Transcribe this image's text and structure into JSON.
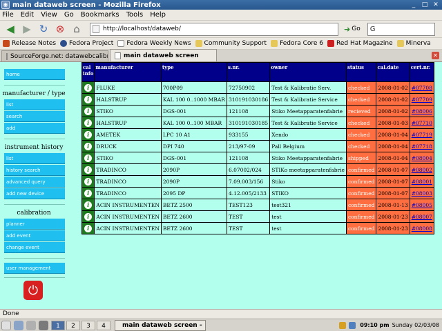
{
  "window": {
    "title": "main dataweb screen - Mozilla Firefox"
  },
  "menu": [
    "File",
    "Edit",
    "View",
    "Go",
    "Bookmarks",
    "Tools",
    "Help"
  ],
  "nav": {
    "url": "http://localhost/dataweb/",
    "go_label": "Go"
  },
  "bookmarks": [
    {
      "label": "Release Notes",
      "color": "#c64a1b"
    },
    {
      "label": "Fedora Project",
      "color": "#2b4d8c"
    },
    {
      "label": "Fedora Weekly News",
      "color": "#ffffff"
    },
    {
      "label": "Community Support",
      "color": "#e6c85a"
    },
    {
      "label": "Fedora Core 6",
      "color": "#e6c85a"
    },
    {
      "label": "Red Hat Magazine",
      "color": "#cc2020"
    },
    {
      "label": "Minerva",
      "color": "#e6c85a"
    }
  ],
  "tabs": [
    {
      "label": "SourceForge.net: datawebcalibr..."
    },
    {
      "label": "main dataweb screen"
    }
  ],
  "sidebar": {
    "home": "home",
    "section1": "manufacturer / type",
    "s1_items": [
      "list",
      "search",
      "add"
    ],
    "section2": "instrument history",
    "s2_items": [
      "list",
      "history search",
      "advanced query",
      "add new device"
    ],
    "section3": "calibration",
    "s3_items": [
      "planner",
      "add event",
      "change event"
    ],
    "user_management": "user management"
  },
  "table": {
    "headers": [
      "cal info",
      "manufacturer",
      "type",
      "s.nr.",
      "owner",
      "status",
      "cal.date",
      "cert.nr."
    ],
    "rows": [
      [
        "FLUKE",
        "700P09",
        "72750902",
        "Test & Kalibratie Serv.",
        "checked",
        "2008-01-02",
        "#07708"
      ],
      [
        "HALSTRUP",
        "KAL 100 0..1000 MBAR",
        "310191030186",
        "Test & Kalibratie Service",
        "checked",
        "2008-01-02",
        "#07709"
      ],
      [
        "STIKO",
        "DGS-001",
        "121108",
        "Stiko Meetapparatenfabrie",
        "recieved",
        "2008-01-02",
        "#08006"
      ],
      [
        "HALSTRUP",
        "KAL 100 0..100 MBAR",
        "310191030185",
        "Test & Kalibratie Service",
        "checked",
        "2008-01-03",
        "#07710"
      ],
      [
        "AMETEK",
        "LPC 10 A1",
        "933155",
        "Xendo",
        "checked",
        "2008-01-04",
        "#07719"
      ],
      [
        "DRUCK",
        "DPI 740",
        "213/97-09",
        "Pall Belgium",
        "checked",
        "2008-01-04",
        "#07718"
      ],
      [
        "STIKO",
        "DGS-001",
        "121108",
        "Stiko Meetapparatenfabrie",
        "shipped",
        "2008-01-04",
        "#08004"
      ],
      [
        "TRADINCO",
        "2090P",
        "6.07002/024",
        "STIKo meetapparatenfabrie",
        "confirmed",
        "2008-01-07",
        "#08002"
      ],
      [
        "TRADINCO",
        "2090P",
        "7.09.003/156",
        "Stiko",
        "confirmed",
        "2008-01-07",
        "#08001"
      ],
      [
        "TRADINCO",
        "2095 DP",
        "4.12.005/2133",
        "STIKO",
        "confirmed",
        "2008-01-07",
        "#08003"
      ],
      [
        "ACIN INSTRUMENTEN",
        "BETZ 2500",
        "TEST123",
        "test321",
        "confirmed",
        "2008-01-13",
        "#08005"
      ],
      [
        "ACIN INSTRUMENTEN",
        "BETZ 2600",
        "TEST",
        "test",
        "confirmed",
        "2008-01-23",
        "#08007"
      ],
      [
        "ACIN INSTRUMENTEN",
        "BETZ 2600",
        "TEST",
        "test",
        "confirmed",
        "2008-01-23",
        "#08008"
      ]
    ]
  },
  "status": {
    "text": "Done"
  },
  "taskbar": {
    "workspaces": [
      "1",
      "2",
      "3",
      "4"
    ],
    "task": "main dataweb screen - ",
    "time": "09:10 pm",
    "date": "Sunday 02/03/08"
  }
}
